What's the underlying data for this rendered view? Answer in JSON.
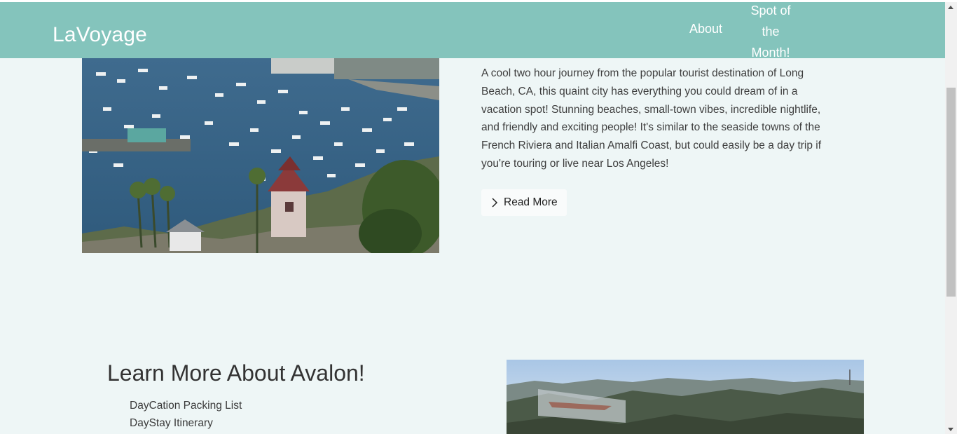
{
  "brand": {
    "name": "LaVoyage"
  },
  "nav": {
    "about_label": "About",
    "spot_label": "Spot of the Month!"
  },
  "feature": {
    "description": "A cool two hour journey from the popular tourist destination of Long Beach, CA, this quaint city has everything you could dream of in a vacation spot! Stunning beaches, small-town vibes, incredible nightlife, and friendly and exciting people! It's similar to the seaside towns of the French Riviera and Italian Amalfi Coast, but could easily be a day trip if you're touring or live near Los Angeles!",
    "read_more_label": "Read More",
    "read_more_icon": "chevron-right-icon"
  },
  "learn_more": {
    "title": "Learn More About Avalon!",
    "links": [
      "DayCation Packing List",
      "DayStay Itinerary"
    ]
  },
  "colors": {
    "navbar": "#84c4bc",
    "page_background": "#eef6f6",
    "button_background": "#f9fbfb"
  }
}
